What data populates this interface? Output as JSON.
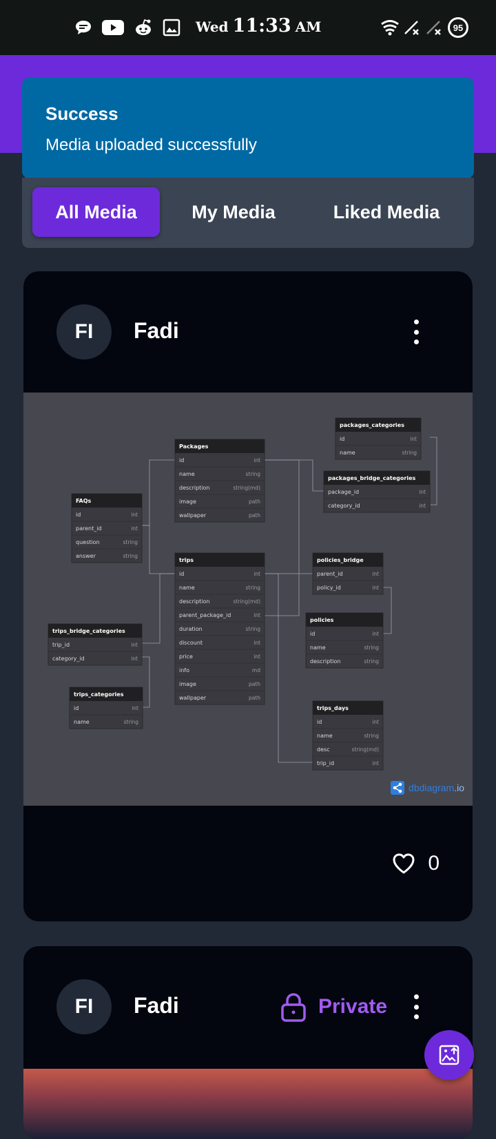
{
  "status_bar": {
    "day": "Wed",
    "time": "11:33",
    "ampm": "AM",
    "battery": "95",
    "left_icons": [
      "chat-bubble-icon",
      "youtube-icon",
      "reddit-icon",
      "image-icon"
    ],
    "right_icons": [
      "wifi-icon",
      "signal-x-icon",
      "signal-x-icon",
      "battery-icon"
    ]
  },
  "toast": {
    "title": "Success",
    "message": "Media uploaded successfully"
  },
  "tabs": [
    {
      "label": "All Media",
      "active": true
    },
    {
      "label": "My Media",
      "active": false
    },
    {
      "label": "Liked Media",
      "active": false
    }
  ],
  "posts": [
    {
      "avatar": "FI",
      "user": "Fadi",
      "likes": "0",
      "diagram": {
        "brand_name": "dbdiagram",
        "brand_tld": ".io",
        "tables": [
          {
            "name": "Packages",
            "fields": [
              [
                "id",
                "int"
              ],
              [
                "name",
                "string"
              ],
              [
                "description",
                "string(md)"
              ],
              [
                "image",
                "path"
              ],
              [
                "wallpaper",
                "path"
              ]
            ]
          },
          {
            "name": "packages_categories",
            "fields": [
              [
                "id",
                "int"
              ],
              [
                "name",
                "string"
              ]
            ]
          },
          {
            "name": "packages_bridge_categories",
            "fields": [
              [
                "package_id",
                "int"
              ],
              [
                "category_id",
                "int"
              ]
            ]
          },
          {
            "name": "FAQs",
            "fields": [
              [
                "id",
                "int"
              ],
              [
                "parent_id",
                "int"
              ],
              [
                "question",
                "string"
              ],
              [
                "answer",
                "string"
              ]
            ]
          },
          {
            "name": "trips",
            "fields": [
              [
                "id",
                "int"
              ],
              [
                "name",
                "string"
              ],
              [
                "description",
                "string(md)"
              ],
              [
                "parent_package_id",
                "int"
              ],
              [
                "duration",
                "string"
              ],
              [
                "discount",
                "int"
              ],
              [
                "price",
                "int"
              ],
              [
                "info",
                "md"
              ],
              [
                "image",
                "path"
              ],
              [
                "wallpaper",
                "path"
              ]
            ]
          },
          {
            "name": "policies_bridge",
            "fields": [
              [
                "parent_id",
                "int"
              ],
              [
                "policy_id",
                "int"
              ]
            ]
          },
          {
            "name": "policies",
            "fields": [
              [
                "id",
                "int"
              ],
              [
                "name",
                "string"
              ],
              [
                "description",
                "string"
              ]
            ]
          },
          {
            "name": "trips_bridge_categories",
            "fields": [
              [
                "trip_id",
                "int"
              ],
              [
                "category_id",
                "int"
              ]
            ]
          },
          {
            "name": "trips_categories",
            "fields": [
              [
                "id",
                "int"
              ],
              [
                "name",
                "string"
              ]
            ]
          },
          {
            "name": "trips_days",
            "fields": [
              [
                "id",
                "int"
              ],
              [
                "name",
                "string"
              ],
              [
                "desc",
                "string(md)"
              ],
              [
                "trip_id",
                "int"
              ]
            ]
          }
        ]
      }
    },
    {
      "avatar": "FI",
      "user": "Fadi",
      "visibility": "Private"
    }
  ],
  "fab": {
    "icon": "upload-image-icon"
  }
}
